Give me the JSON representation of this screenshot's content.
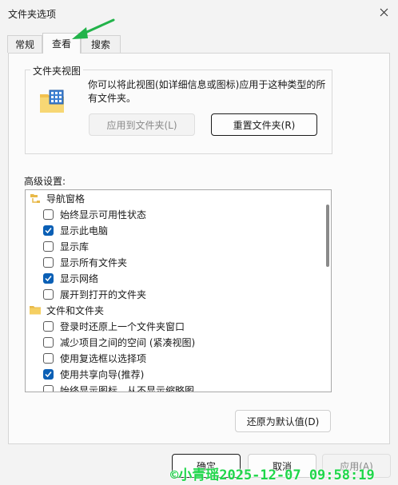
{
  "window": {
    "title": "文件夹选项"
  },
  "tabs": [
    {
      "label": "常规",
      "active": false
    },
    {
      "label": "查看",
      "active": true
    },
    {
      "label": "搜索",
      "active": false
    }
  ],
  "folder_views": {
    "title": "文件夹视图",
    "description": "你可以将此视图(如详细信息或图标)应用于这种类型的所有文件夹。",
    "apply_button": "应用到文件夹(L)",
    "reset_button": "重置文件夹(R)"
  },
  "advanced": {
    "label": "高级设置:",
    "items": [
      {
        "type": "category",
        "icon": "navigation-pane-icon",
        "label": "导航窗格"
      },
      {
        "type": "checkbox",
        "checked": false,
        "label": "始终显示可用性状态"
      },
      {
        "type": "checkbox",
        "checked": true,
        "label": "显示此电脑"
      },
      {
        "type": "checkbox",
        "checked": false,
        "label": "显示库"
      },
      {
        "type": "checkbox",
        "checked": false,
        "label": "显示所有文件夹"
      },
      {
        "type": "checkbox",
        "checked": true,
        "label": "显示网络"
      },
      {
        "type": "checkbox",
        "checked": false,
        "label": "展开到打开的文件夹"
      },
      {
        "type": "category",
        "icon": "folder-icon",
        "label": "文件和文件夹"
      },
      {
        "type": "checkbox",
        "checked": false,
        "label": "登录时还原上一个文件夹窗口"
      },
      {
        "type": "checkbox",
        "checked": false,
        "label": "减少项目之间的空间 (紧凑视图)"
      },
      {
        "type": "checkbox",
        "checked": false,
        "label": "使用复选框以选择项"
      },
      {
        "type": "checkbox",
        "checked": true,
        "label": "使用共享向导(推荐)"
      },
      {
        "type": "checkbox",
        "checked": false,
        "label": "始终显示图标，从不显示缩略图"
      }
    ],
    "restore_button": "还原为默认值(D)"
  },
  "footer": {
    "ok": "确定",
    "cancel": "取消",
    "apply": "应用(A)"
  },
  "watermark": "©小青瑶2025-12-07 09:58:19",
  "colors": {
    "accent": "#0a5fb5",
    "watermark": "#1fd64a",
    "arrow": "#22b34a"
  }
}
